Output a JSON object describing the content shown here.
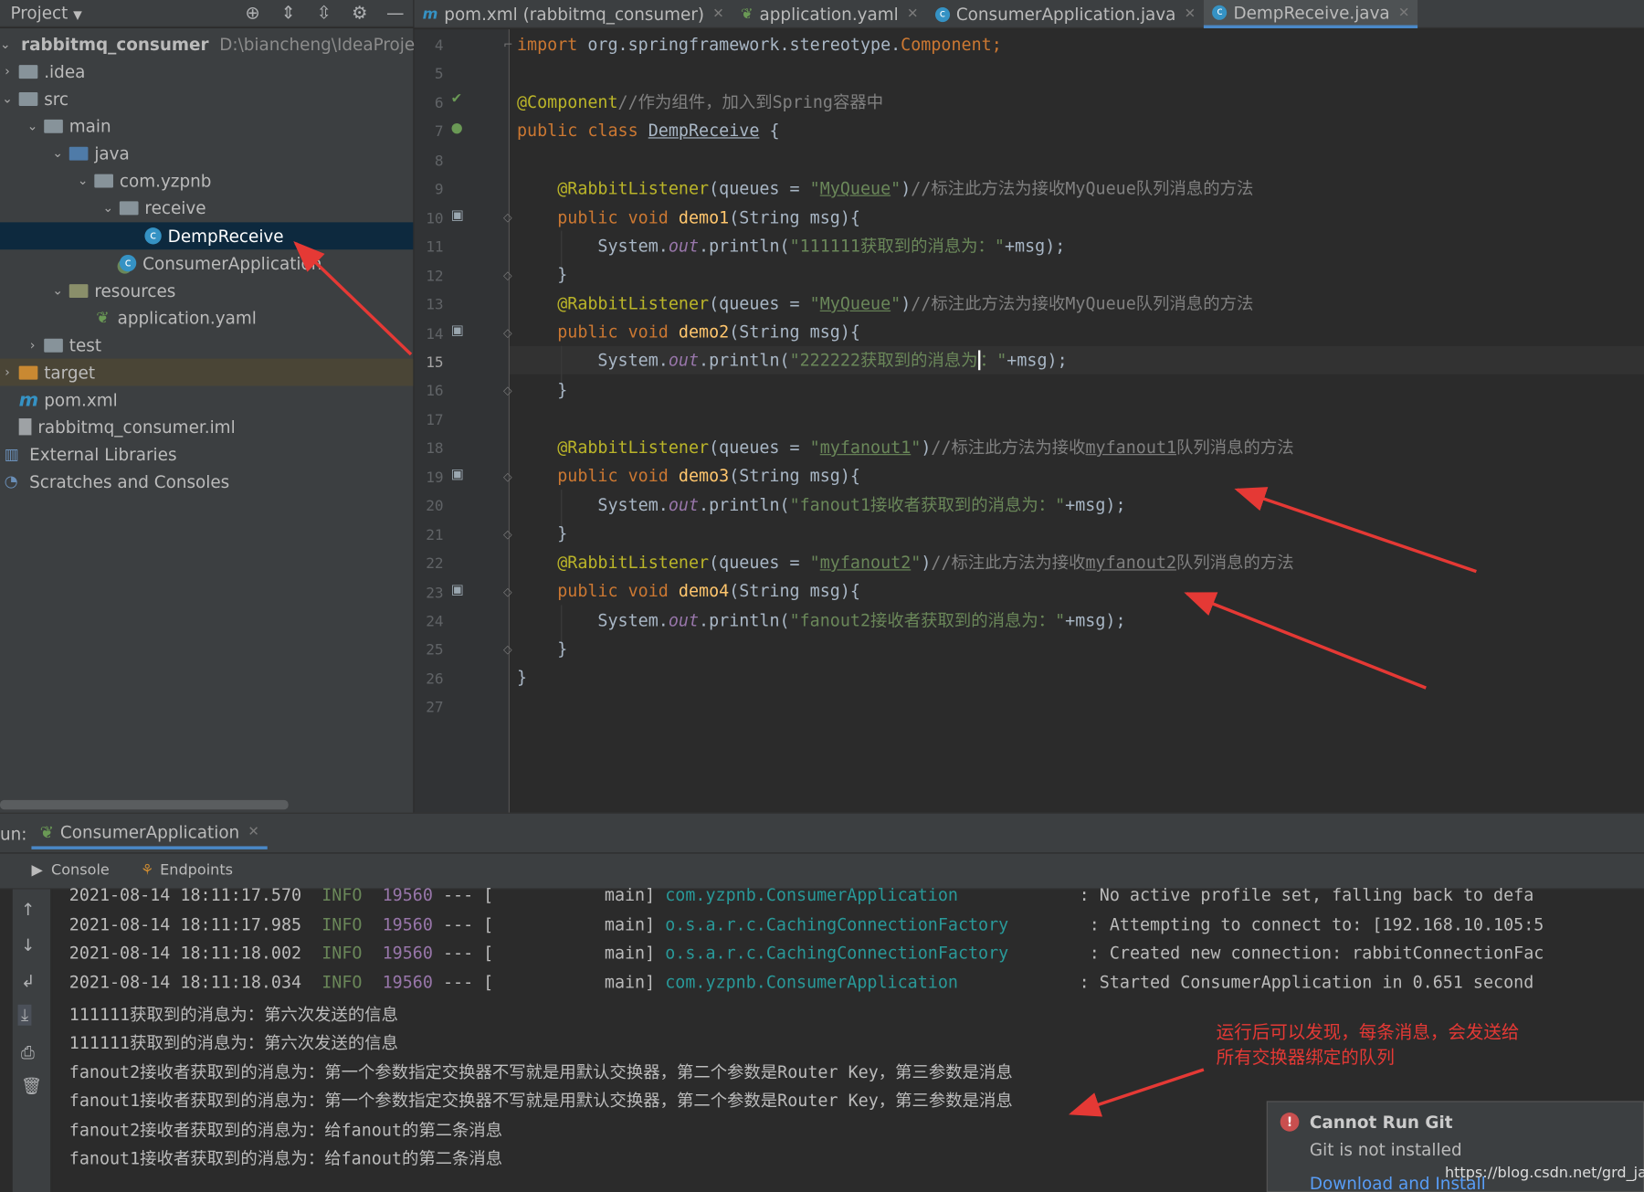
{
  "project_header": {
    "title": "Project",
    "dropdown": "▼"
  },
  "tree": {
    "root": {
      "name": "rabbitmq_consumer",
      "path": "D:\\biancheng\\IdeaProjects"
    },
    "idea": ".idea",
    "src": "src",
    "main": "main",
    "java": "java",
    "pkg": "com.yzpnb",
    "receive": "receive",
    "demp": "DempReceive",
    "consumer_app": "ConsumerApplication",
    "resources": "resources",
    "app_yaml": "application.yaml",
    "test": "test",
    "target": "target",
    "pom": "pom.xml",
    "iml": "rabbitmq_consumer.iml",
    "ext_libs": "External Libraries",
    "scratches": "Scratches and Consoles"
  },
  "tabs": [
    {
      "label": "pom.xml (rabbitmq_consumer)",
      "icon": "m"
    },
    {
      "label": "application.yaml",
      "icon": "leaf"
    },
    {
      "label": "ConsumerApplication.java",
      "icon": "spring-class"
    },
    {
      "label": "DempReceive.java",
      "icon": "class",
      "active": true
    }
  ],
  "line_numbers": [
    "4",
    "5",
    "6",
    "7",
    "8",
    "9",
    "10",
    "11",
    "12",
    "13",
    "14",
    "15",
    "16",
    "17",
    "18",
    "19",
    "20",
    "21",
    "22",
    "23",
    "24",
    "25",
    "26",
    "27"
  ],
  "code": {
    "l4_kw": "import",
    "l4_rest": " org.springframework.stereotype.",
    "l4_cls": "Component",
    "l4_end": ";",
    "l6_an": "@Component",
    "l6_cm": "//作为组件，加入到Spring容器中",
    "l7_kw": "public class ",
    "l7_name": "DempReceive",
    "l7_end": " {",
    "listener": "@RabbitListener",
    "queues": "(queues = ",
    "q1": "MyQueue",
    "q3": "myfanout1",
    "q4": "myfanout2",
    "c1": "//标注此方法为接收MyQueue队列消息的方法",
    "c3a": "//标注此方法为接收",
    "c3b": "myfanout1",
    "c3c": "队列消息的方法",
    "c4a": "//标注此方法为接收",
    "c4b": "myfanout2",
    "c4c": "队列消息的方法",
    "pv": "public void ",
    "d1": "demo1",
    "d2": "demo2",
    "d3": "demo3",
    "d4": "demo4",
    "params": "(String msg){",
    "sys": "System.",
    "out": "out",
    "println": ".println(",
    "s1": "\"111111获取到的消息为：\"",
    "s2a": "\"222222获取到的消息为",
    "s2b": "：\"",
    "s3": "\"fanout1接收者获取到的消息为：\"",
    "s4": "\"fanout2接收者获取到的消息为：\"",
    "tail": "+msg);",
    "close": "}"
  },
  "run": {
    "label": "un:",
    "tab": "ConsumerApplication",
    "console_tab": "Console",
    "endpoints_tab": "Endpoints"
  },
  "logs": [
    {
      "ts": "2021-08-14 18:11:17.570",
      "lvl": "INFO",
      "pid": "19560",
      "sep": " --- [           main] ",
      "cls": "com.yzpnb.ConsumerApplication           ",
      "msg": " : No active profile set, falling back to defa"
    },
    {
      "ts": "2021-08-14 18:11:17.985",
      "lvl": "INFO",
      "pid": "19560",
      "sep": " --- [           main] ",
      "cls": "o.s.a.r.c.CachingConnectionFactory       ",
      "msg": " : Attempting to connect to: [192.168.10.105:5"
    },
    {
      "ts": "2021-08-14 18:11:18.002",
      "lvl": "INFO",
      "pid": "19560",
      "sep": " --- [           main] ",
      "cls": "o.s.a.r.c.CachingConnectionFactory       ",
      "msg": " : Created new connection: rabbitConnectionFac"
    },
    {
      "ts": "2021-08-14 18:11:18.034",
      "lvl": "INFO",
      "pid": "19560",
      "sep": " --- [           main] ",
      "cls": "com.yzpnb.ConsumerApplication           ",
      "msg": " : Started ConsumerApplication in 0.651 second"
    }
  ],
  "output": [
    "111111获取到的消息为：第六次发送的信息",
    "111111获取到的消息为：第六次发送的信息",
    "fanout2接收者获取到的消息为：第一个参数指定交换器不写就是用默认交换器，第二个参数是Router Key，第三参数是消息",
    "fanout1接收者获取到的消息为：第一个参数指定交换器不写就是用默认交换器，第二个参数是Router Key，第三参数是消息",
    "fanout2接收者获取到的消息为：给fanout的第二条消息",
    "fanout1接收者获取到的消息为：给fanout的第二条消息"
  ],
  "note": {
    "line1": "运行后可以发现，每条消息，会发送给",
    "line2": "所有交换器绑定的队列"
  },
  "popup": {
    "title": "Cannot Run Git",
    "message": "Git is not installed",
    "link": "Download and Install"
  },
  "watermark": "https://blog.csdn.net/grd_java",
  "colors": {
    "accent": "#4a88c7",
    "annotation": "#e53935"
  }
}
